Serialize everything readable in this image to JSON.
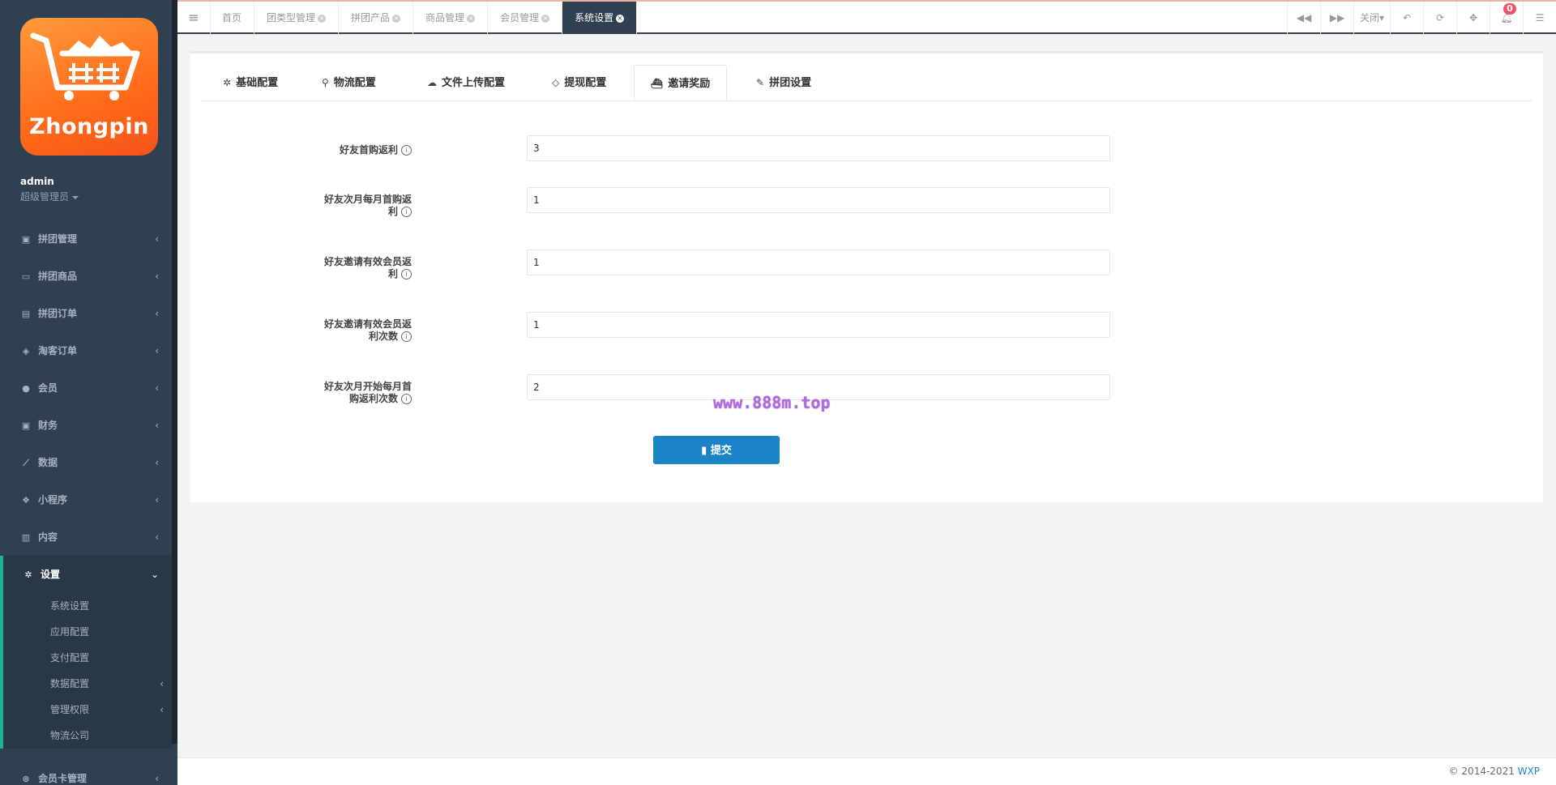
{
  "sidebar": {
    "logo_text": "Zhongpin",
    "user": {
      "name": "admin",
      "role": "超级管理员"
    },
    "items": [
      {
        "label": "拼团管理",
        "icon": "train-icon"
      },
      {
        "label": "拼团商品",
        "icon": "laptop-icon"
      },
      {
        "label": "拼团订单",
        "icon": "list-icon"
      },
      {
        "label": "淘客订单",
        "icon": "cube-icon"
      },
      {
        "label": "会员",
        "icon": "user-icon"
      },
      {
        "label": "财务",
        "icon": "money-icon"
      },
      {
        "label": "数据",
        "icon": "line-chart-icon"
      },
      {
        "label": "小程序",
        "icon": "cubes-icon"
      },
      {
        "label": "内容",
        "icon": "book-icon"
      },
      {
        "label": "设置",
        "icon": "gear-icon"
      }
    ],
    "sub_items": [
      {
        "label": "系统设置"
      },
      {
        "label": "应用配置"
      },
      {
        "label": "支付配置"
      },
      {
        "label": "数据配置"
      },
      {
        "label": "管理权限"
      },
      {
        "label": "物流公司"
      }
    ],
    "bottom_item": {
      "label": "会员卡管理",
      "icon": "card-icon"
    }
  },
  "topbar": {
    "tabs": [
      "首页",
      "团类型管理",
      "拼团产品",
      "商品管理",
      "会员管理",
      "系统设置"
    ],
    "active_tab": "系统设置",
    "close_label": "关闭",
    "notification_count": "0"
  },
  "form": {
    "tabs": [
      "基础配置",
      "物流配置",
      "文件上传配置",
      "提现配置",
      "邀请奖励",
      "拼团设置"
    ],
    "active_tab": "邀请奖励",
    "fields": [
      {
        "label": "好友首购返利",
        "value": "3"
      },
      {
        "label_lines": [
          "好友次月每月首购返",
          "利"
        ],
        "value": "1"
      },
      {
        "label_lines": [
          "好友邀请有效会员返",
          "利"
        ],
        "value": "1"
      },
      {
        "label_lines": [
          "好友邀请有效会员返",
          "利次数"
        ],
        "value": "1"
      },
      {
        "label_lines": [
          "好友次月开始每月首",
          "购返利次数"
        ],
        "value": "2"
      }
    ],
    "submit_label": "提交"
  },
  "watermark": "www.888m.top",
  "footer": {
    "copyright": "© 2014-2021",
    "brand": "WXP"
  },
  "colors": {
    "sidebar_bg": "#2f4050",
    "active_tab_bg": "#2f4050",
    "accent": "#1ab394",
    "primary_button": "#1c84c6",
    "badge": "#ed5565",
    "logo_orange": "#ff6b1a"
  }
}
